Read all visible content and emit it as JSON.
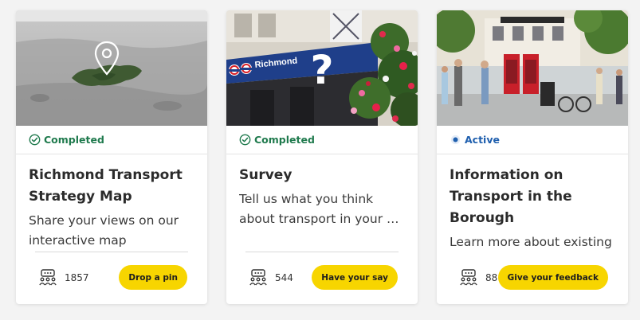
{
  "colors": {
    "accent_yellow": "#f7d500",
    "completed_green": "#1f7a4d",
    "active_blue": "#1f5fae"
  },
  "cards": [
    {
      "image_alt": "aerial-map-with-location-pin",
      "image_icon": "map-pin-icon",
      "status": "Completed",
      "status_icon": "check-circle-icon",
      "title": "Richmond Transport Strategy Map",
      "description": "Share your views on our interactive map",
      "participants": "1857",
      "participants_icon": "people-group-icon",
      "cta_label": "Drop a pin"
    },
    {
      "image_alt": "richmond-underground-station-with-flowers",
      "image_icon": "question-mark-icon",
      "sign_text": "Richmond",
      "status": "Completed",
      "status_icon": "check-circle-icon",
      "title": "Survey",
      "description": "Tell us what you think about transport in your …",
      "participants": "544",
      "participants_icon": "people-group-icon",
      "cta_label": "Have your say"
    },
    {
      "image_alt": "street-scene-with-red-phone-boxes",
      "status": "Active",
      "status_icon": "active-dot-icon",
      "title": "Information on Transport in the Borough",
      "description": "Learn more about existing",
      "participants": "88",
      "participants_icon": "people-group-icon",
      "cta_label": "Give your feedback"
    }
  ]
}
